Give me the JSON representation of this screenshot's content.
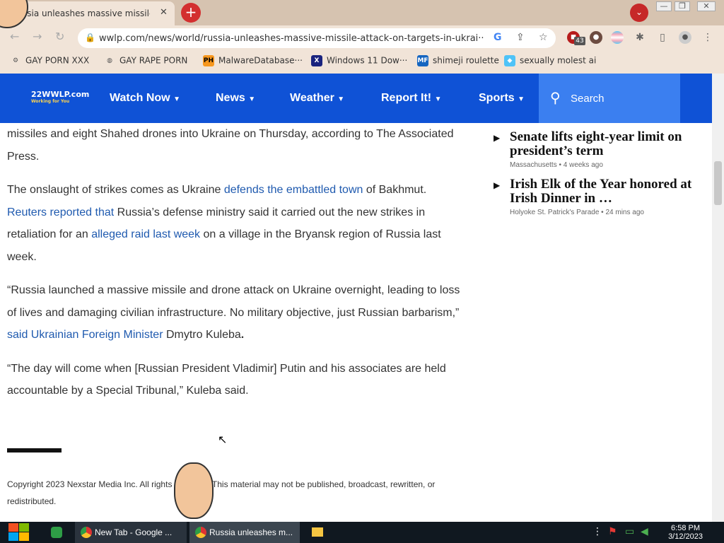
{
  "browser": {
    "tab_title": "ssia unleashes massive missile",
    "tab_close": "✕",
    "new_tab": "+",
    "url": "wwlp.com/news/world/russia-unleashes-massive-missile-attack-on-targets-in-ukrai···",
    "extension_badge": "43",
    "bookmarks": [
      {
        "label": "GAY PORN XXX",
        "icon": "gear-icon"
      },
      {
        "label": "GAY RAPE PORN",
        "icon": "globe-icon"
      },
      {
        "label": "MalwareDatabase···",
        "icon": "ph-icon"
      },
      {
        "label": "Windows 11 Dow···",
        "icon": "x-icon"
      },
      {
        "label": "shimeji roulette",
        "icon": "mf-icon"
      },
      {
        "label": "sexually molest ai",
        "icon": "bookmark-icon"
      }
    ]
  },
  "site": {
    "logo": "22WWLP.com",
    "logo_tagline": "Working for You",
    "nav": [
      "Watch Now",
      "News",
      "Weather",
      "Report It!",
      "Sports"
    ],
    "search_placeholder": "Search"
  },
  "article": {
    "p1": "missiles and eight Shahed drones into Ukraine on Thursday, according to The Associated Press.",
    "p2a": "The onslaught of strikes comes as Ukraine ",
    "p2_link1": "defends the embattled town",
    "p2b": " of Bakhmut. ",
    "p2_link2": "Reuters reported that",
    "p2c": " Russia’s defense ministry said it carried out the new strikes in retaliation for an ",
    "p2_link3": "alleged raid last week",
    "p2d": " on a village in the Bryansk region of Russia last week.",
    "p3a": "“Russia launched a massive missile and drone attack on Ukraine overnight, leading to loss of lives and damaging civilian infrastructure. No military objective, just Russian barbarism,” ",
    "p3_link": "said Ukrainian Foreign Minister",
    "p3b": " Dmytro Kuleba",
    "p3_end": ".",
    "p4": "“The day will come when [Russian President Vladimir] Putin and his associates are held accountable by a Special Tribunal,” Kuleba said.",
    "copyright": "Copyright 2023 Nexstar Media Inc. All rights reserved. This material may not be published, broadcast, rewritten, or redistributed."
  },
  "sidebar": [
    {
      "title": "Senate lifts eight-year limit on president’s term",
      "meta": "Massachusetts • 4 weeks ago"
    },
    {
      "title": "Irish Elk of the Year honored at Irish Dinner in …",
      "meta": "Holyoke St. Patrick's Parade • 24 mins ago"
    }
  ],
  "taskbar": {
    "apps": [
      "New Tab - Google ...",
      "Russia unleashes m..."
    ],
    "time": "6:58 PM",
    "date": "3/12/2023"
  }
}
